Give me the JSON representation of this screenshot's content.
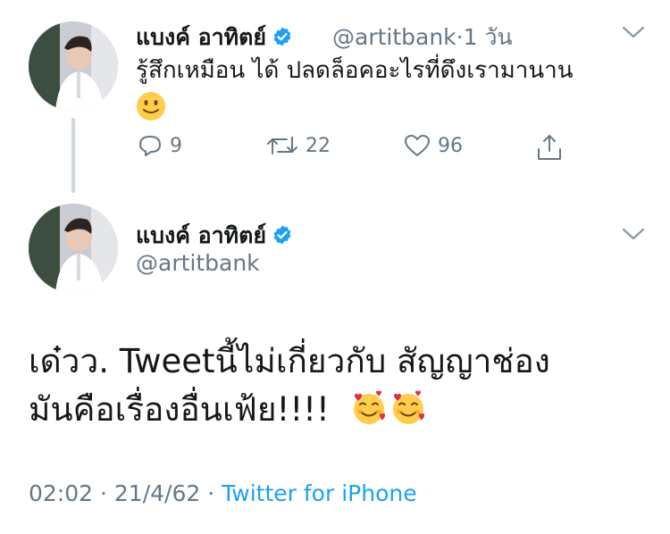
{
  "tweet1": {
    "display_name": "แบงค์ อาทิตย์",
    "handle": "@artitbank",
    "separator": "·",
    "time_ago": "1 วัน",
    "text": "รู้สึกเหมือน ได้ ปลดล็อคอะไรที่ดึงเรามานาน",
    "emoji": "slightly-smiling-face",
    "actions": {
      "replies": "9",
      "retweets": "22",
      "likes": "96"
    }
  },
  "tweet2": {
    "display_name": "แบงค์ อาทิตย์",
    "handle": "@artitbank",
    "text_line1": "เด๋วว. Tweetนี้ไม่เกี่ยวกับ สัญญาช่อง",
    "text_line2": "มันคือเรื่องอื่นเฟ้ย!!!!",
    "emojis": [
      "smiling-face-with-hearts",
      "smiling-face-with-hearts"
    ],
    "time": "02:02",
    "sep1": "·",
    "date": "21/4/62",
    "sep2": "·",
    "source": "Twitter for iPhone"
  },
  "colors": {
    "verified": "#1da1f2",
    "secondary_text": "#657786",
    "link": "#1da1f2",
    "thread_line": "#ccd6dd"
  }
}
